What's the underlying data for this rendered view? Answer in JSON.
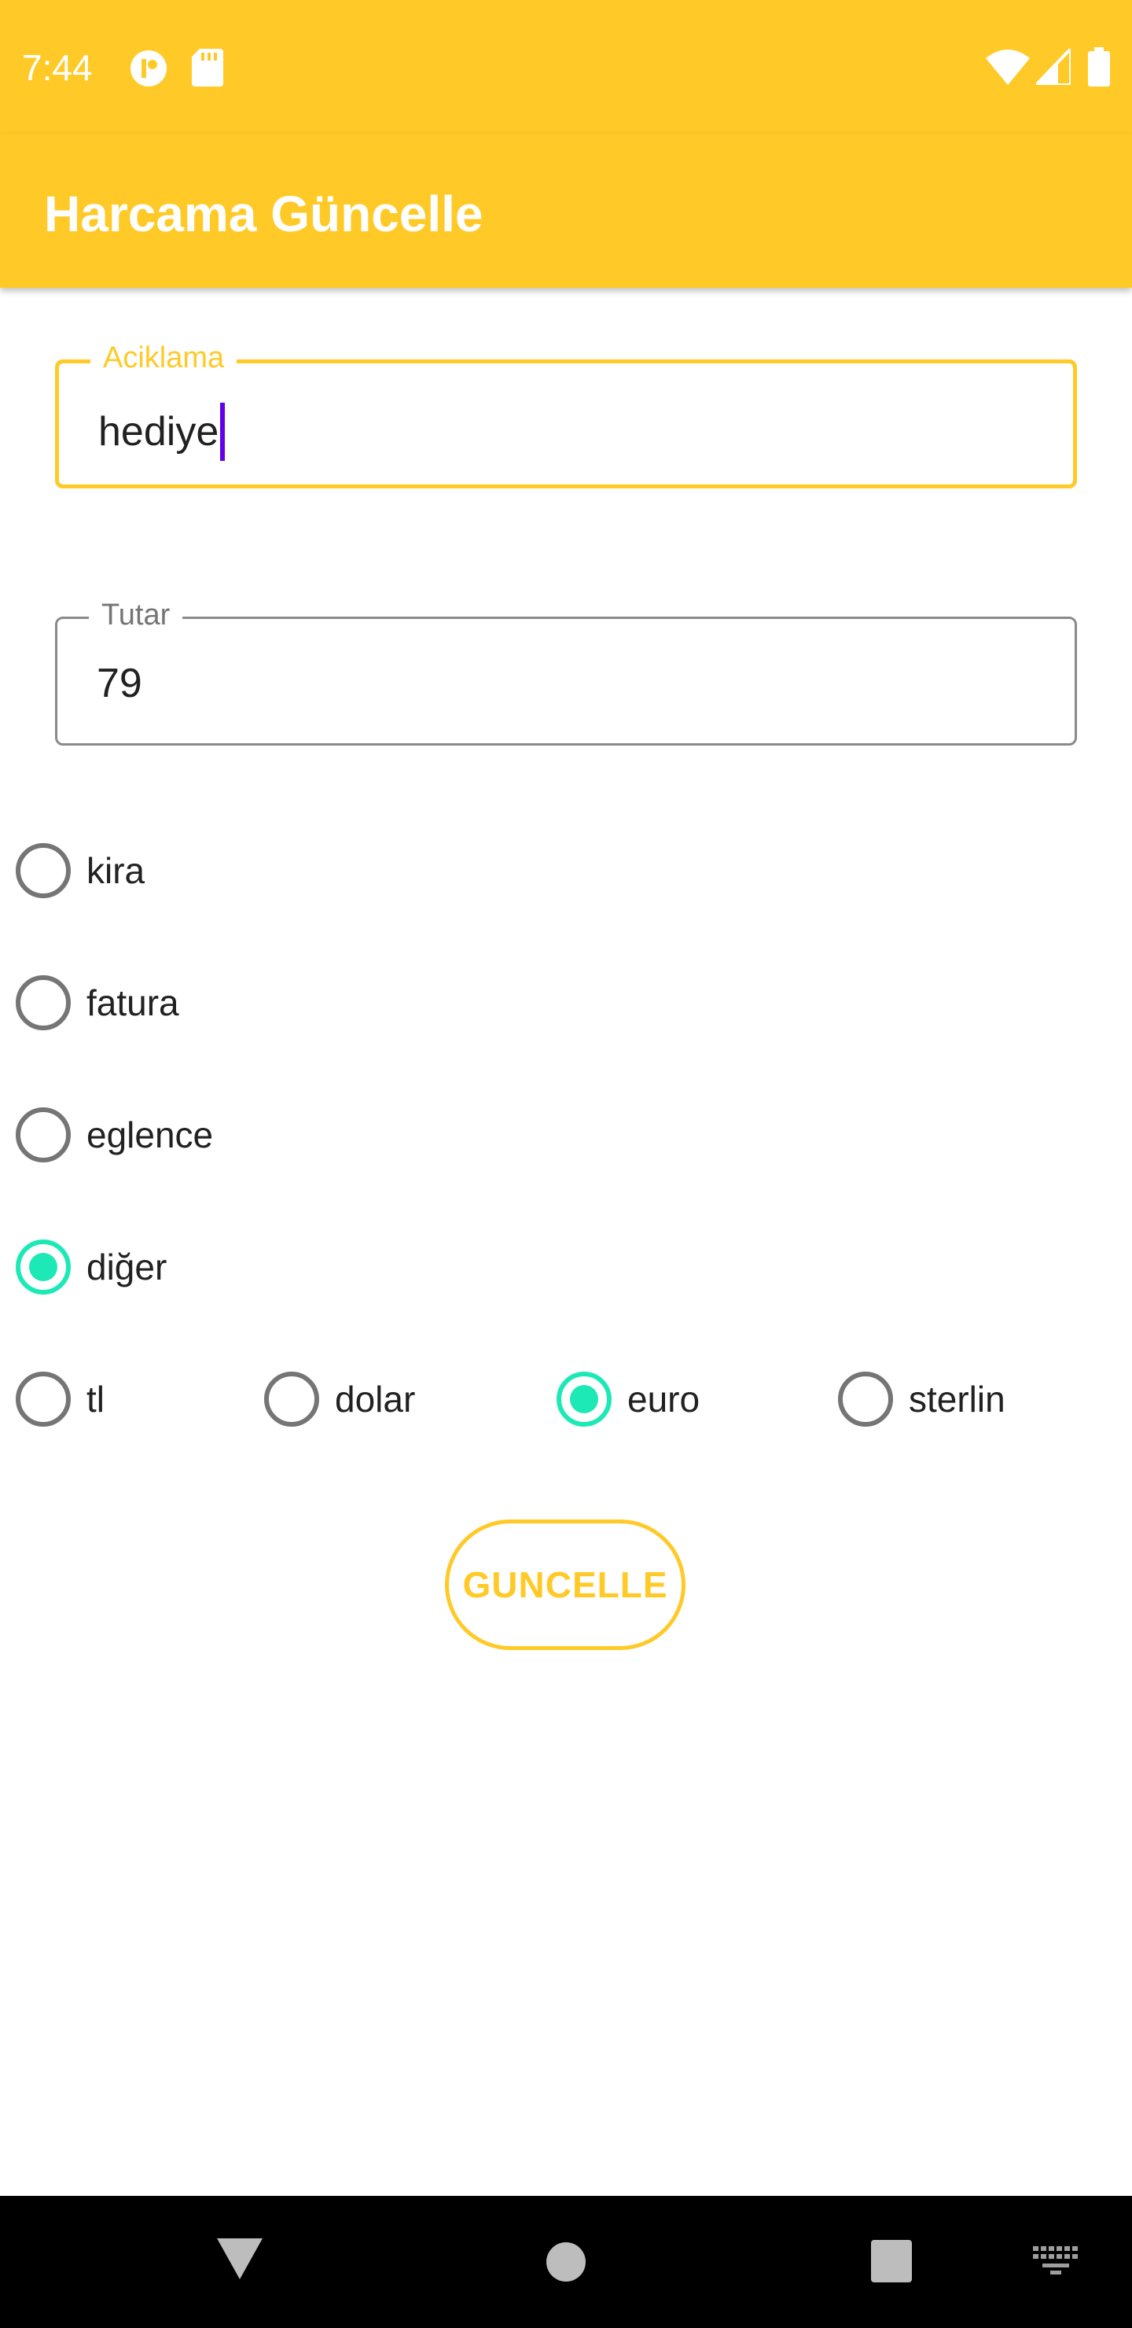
{
  "status_bar": {
    "time": "7:44"
  },
  "app_bar": {
    "title": "Harcama Güncelle"
  },
  "form": {
    "description_field": {
      "label": "Aciklama",
      "value": "hediye"
    },
    "amount_field": {
      "label": "Tutar",
      "value": "79"
    },
    "categories": [
      {
        "label": "kira",
        "checked": false
      },
      {
        "label": "fatura",
        "checked": false
      },
      {
        "label": "eglence",
        "checked": false
      },
      {
        "label": "diğer",
        "checked": true
      }
    ],
    "currencies": [
      {
        "label": "tl",
        "checked": false
      },
      {
        "label": "dolar",
        "checked": false
      },
      {
        "label": "euro",
        "checked": true
      },
      {
        "label": "sterlin",
        "checked": false
      }
    ],
    "submit_label": "GUNCELLE"
  },
  "colors": {
    "primary": "#FFCA28",
    "accent": "#1DE9B6",
    "caret": "#6200EE"
  },
  "icons": {
    "status": [
      "notification-icon",
      "sd-card-icon",
      "wifi-icon",
      "signal-icon",
      "battery-icon"
    ],
    "nav": [
      "back-icon",
      "home-icon",
      "recents-icon",
      "keyboard-icon"
    ]
  }
}
